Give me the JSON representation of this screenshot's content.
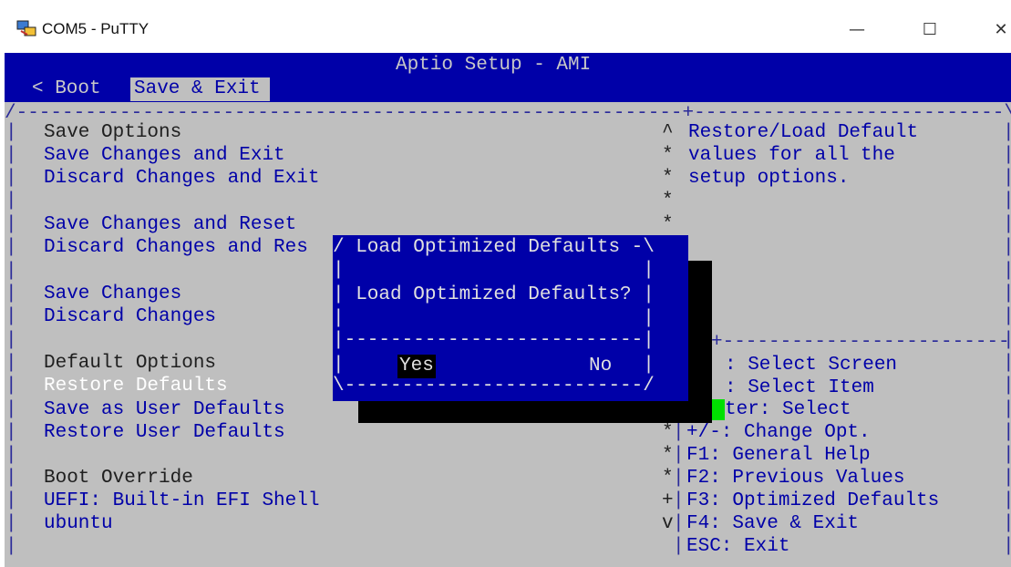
{
  "window": {
    "title": "COM5 - PuTTY",
    "minimize_glyph": "—",
    "maximize_glyph": "☐",
    "close_glyph": "✕"
  },
  "header": {
    "title": "Aptio Setup - AMI",
    "tabs": [
      {
        "label": "< Boot"
      },
      {
        "label": "Save & Exit"
      }
    ],
    "active_tab": "Save & Exit"
  },
  "frame": {
    "top_border": "/----------------------------------------------------------+---------------------------\\",
    "vbar": "|",
    "right_divider": "+---------------------------"
  },
  "menu": {
    "items": [
      {
        "label": "Save Options",
        "kind": "heading"
      },
      {
        "label": "Save Changes and Exit",
        "kind": "item"
      },
      {
        "label": "Discard Changes and Exit",
        "kind": "item"
      },
      {
        "label": "Save Changes and Reset",
        "kind": "item"
      },
      {
        "label": "Discard Changes and Res",
        "kind": "item"
      },
      {
        "label": "Save Changes",
        "kind": "item"
      },
      {
        "label": "Discard Changes",
        "kind": "item"
      },
      {
        "label": "Default Options",
        "kind": "heading"
      },
      {
        "label": "Restore Defaults",
        "kind": "selected"
      },
      {
        "label": "Save as User Defaults",
        "kind": "item"
      },
      {
        "label": "Restore User Defaults",
        "kind": "item"
      },
      {
        "label": "Boot Override",
        "kind": "heading"
      },
      {
        "label": "UEFI: Built-in EFI Shell",
        "kind": "item"
      },
      {
        "label": "ubuntu",
        "kind": "item"
      }
    ]
  },
  "help": {
    "lines": [
      "Restore/Load Default",
      "values for all the",
      "setup options."
    ],
    "scroll_marks": [
      "^",
      "*",
      "*",
      "*",
      "*",
      "*",
      "*",
      "*",
      "+",
      "v"
    ],
    "key_help": [
      ": Select Screen",
      ": Select Item",
      "ter: Select",
      "+/-: Change Opt.",
      "F1: General Help",
      "F2: Previous Values",
      "F3: Optimized Defaults",
      "F4: Save & Exit",
      "ESC: Exit"
    ]
  },
  "dialog": {
    "title_line": "/ Load Optimized Defaults -\\",
    "message_line": "| Load Optimized Defaults? |",
    "empty_line": "|                          |",
    "separator_line": "|--------------------------|",
    "bottom_line": "\\--------------------------/",
    "options": {
      "yes": "Yes",
      "no": "No"
    },
    "selected_option": "Yes"
  },
  "colors": {
    "background": "#bfbfbf",
    "accent_blue": "#0000a8",
    "selection_green": "#00e000"
  }
}
